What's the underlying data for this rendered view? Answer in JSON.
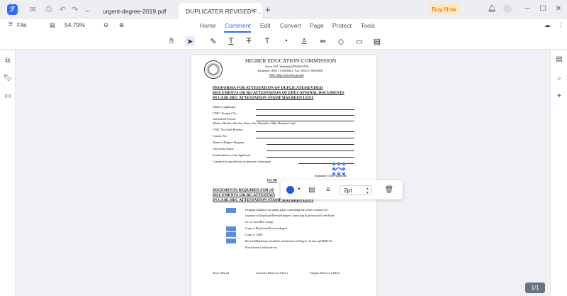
{
  "titlebar": {
    "tabs": [
      {
        "label": "urgent-degree-2019.pdf"
      },
      {
        "label": "DUPLICATER  REVISED F..."
      }
    ],
    "buy_now": "Buy Now"
  },
  "menubar": {
    "file": "File",
    "zoom": "54.79%",
    "tabs": [
      "Home",
      "Comment",
      "Edit",
      "Convert",
      "Page",
      "Protect",
      "Tools"
    ],
    "active_tab": "Comment"
  },
  "document": {
    "commission": "HIGHER EDUCATION COMMISSION",
    "address1": "Sector H-9, Islamabad (PAKISTAN)",
    "address2": "Telephone: 0092 51 90400011, Fax: 0092 51 90400902",
    "url": "URL: http://www.hec.gov.pk",
    "proforma": [
      "PROFORMA      FOR      ATTESTATION      OF      DUPLICATE/REVISED",
      "DOCUMENTS OR RE-ATTESTATION OF EDUCATIONAL DOCUMENTS",
      "IN CASE HEC ATTESTATION STAMP HAS BEEN LOST"
    ],
    "fields": [
      "Name of applicant:",
      "CNIC/ Passport No:",
      "Authorized Person:",
      "(Father, Mother, Brother, Sister, Son, Daughter, Wife, Husband only)",
      "CNIC No (Auth Person):",
      "Contact No:",
      "Name of Degree Program",
      "University Name",
      "Email address of the Applicant",
      "Consent for cancellation of previous Attestation"
    ],
    "signature_label": "Signature of the Applicant",
    "for_office": "For Off",
    "required": [
      "DOCUMENTS REQUIRED FOR AT",
      "DOCUMENTS OR RE-ATTESTATI",
      "IN CASE HEC ATTESTATION STAMP HAS BEEN LOST"
    ],
    "items": [
      "Original Affidavit on stamp paper containing the whole scenario for",
      "issuance of Duplicate/Revised degree, transcript & provisional certificate",
      "etc. or lost HEC stamp",
      "Copy of Duplicate/Revised degree",
      "Copy of CNIC",
      "Revised/Duplicate should be mentioned on Degree, Transcript/DMC &",
      "Provisional Certificate etc."
    ],
    "signatories": [
      "Desk Official",
      "Assistant Director (A&A)",
      "Deputy Director (A&A)"
    ]
  },
  "annotation_toolbar": {
    "color": "#2255e3",
    "stroke_width": "2pt"
  },
  "page_indicator": "1/1"
}
